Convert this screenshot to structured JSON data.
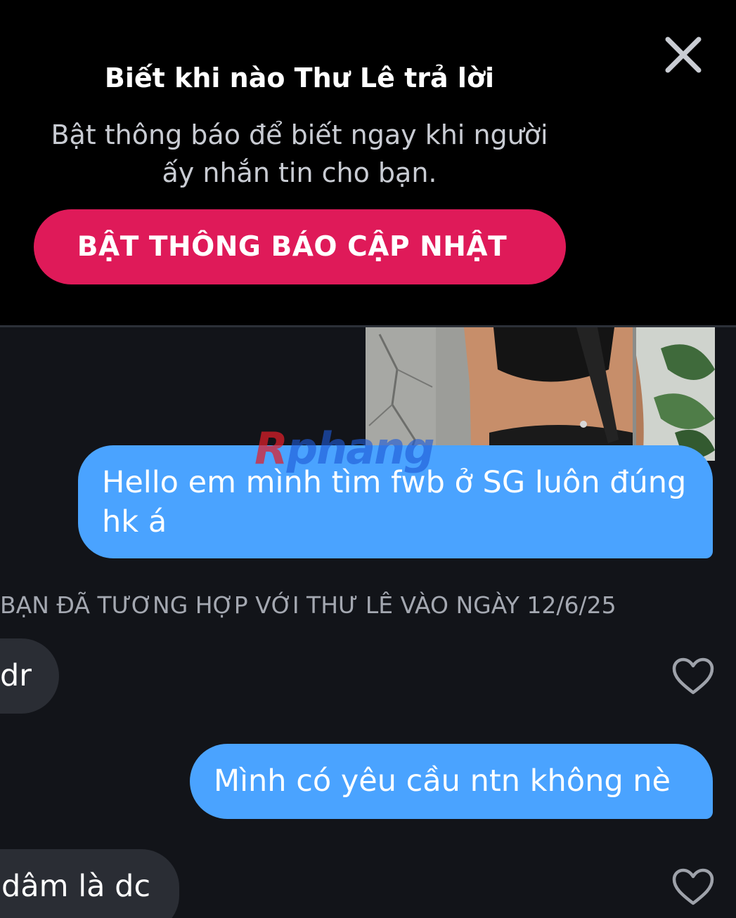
{
  "banner": {
    "title": "Biết khi nào Thư Lê trả lời",
    "body_line1": "Bật thông báo để biết ngay khi người",
    "body_line2": "ấy nhắn tin cho bạn.",
    "cta_label": "BẬT THÔNG BÁO CẬP NHẬT",
    "close_icon": "close-icon"
  },
  "chat": {
    "photo": "photo-thumbnail",
    "messages": [
      {
        "direction": "sent",
        "text": "Hello em mình tìm fwb ở SG luôn đúng hk á"
      }
    ],
    "match_notice": "BẠN ĐÃ TƯƠNG HỢP VỚI THƯ LÊ VÀO NGÀY 12/6/25",
    "after_match": [
      {
        "direction": "received",
        "text": "dr",
        "like_icon": "heart-icon"
      },
      {
        "direction": "sent",
        "text": "Mình có yêu cầu ntn không nè"
      },
      {
        "direction": "received",
        "text": "dâm là dc",
        "like_icon": "heart-icon"
      }
    ]
  },
  "watermark": {
    "first": "R",
    "rest": "phang"
  },
  "colors": {
    "banner_bg": "#000000",
    "chat_bg": "#121419",
    "cta": "#df1a59",
    "sent_bubble": "#4aa3ff",
    "received_bubble": "#2a2d34"
  }
}
